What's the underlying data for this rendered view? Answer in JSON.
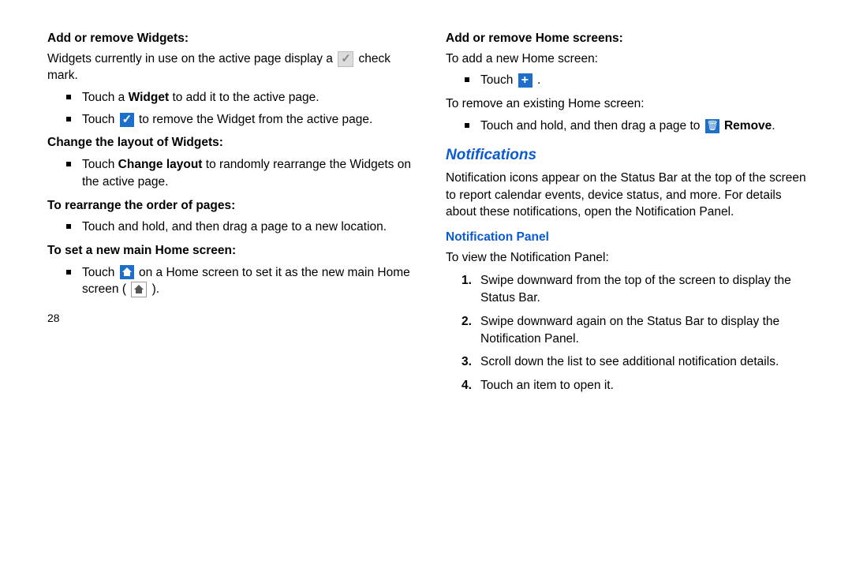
{
  "pageNumber": "28",
  "left": {
    "s1_h": "Add or remove Widgets:",
    "s1_p_a": "Widgets currently in use on the active page display a ",
    "s1_p_b": " check mark.",
    "s1_b1_a": "Touch a ",
    "s1_b1_b": "Widget",
    "s1_b1_c": " to add it to the active page.",
    "s1_b2_a": "Touch ",
    "s1_b2_b": " to remove the Widget from the active page.",
    "s2_h": "Change the layout of Widgets:",
    "s2_b1_a": "Touch ",
    "s2_b1_b": "Change layout",
    "s2_b1_c": " to randomly rearrange the Widgets on the active page.",
    "s3_h": "To rearrange the order of pages:",
    "s3_b1": "Touch and hold, and then drag a page to a new location.",
    "s4_h": "To set a new main Home screen:",
    "s4_b1_a": "Touch ",
    "s4_b1_b": " on a Home screen to set it as the new main Home screen ( ",
    "s4_b1_c": " )."
  },
  "right": {
    "s5_h": "Add or remove Home screens:",
    "s5_p1": "To add a new Home screen:",
    "s5_b1_a": "Touch ",
    "s5_b1_b": " .",
    "s5_p2": "To remove an existing Home screen:",
    "s5_b2_a": "Touch and hold, and then drag a page to ",
    "s5_b2_b": "Remove",
    "s5_b2_c": ".",
    "h_notif": "Notifications",
    "notif_p": "Notification icons appear on the Status Bar at the top of the screen to report calendar events, device status, and more. For details about these notifications, open the Notification Panel.",
    "h_np": "Notification Panel",
    "np_p": "To view the Notification Panel:",
    "np_1": "Swipe downward from the top of the screen to display the Status Bar.",
    "np_2": "Swipe downward again on the Status Bar to display the Notification Panel.",
    "np_3": "Scroll down the list to see additional notification details.",
    "np_4": "Touch an item to open it."
  }
}
